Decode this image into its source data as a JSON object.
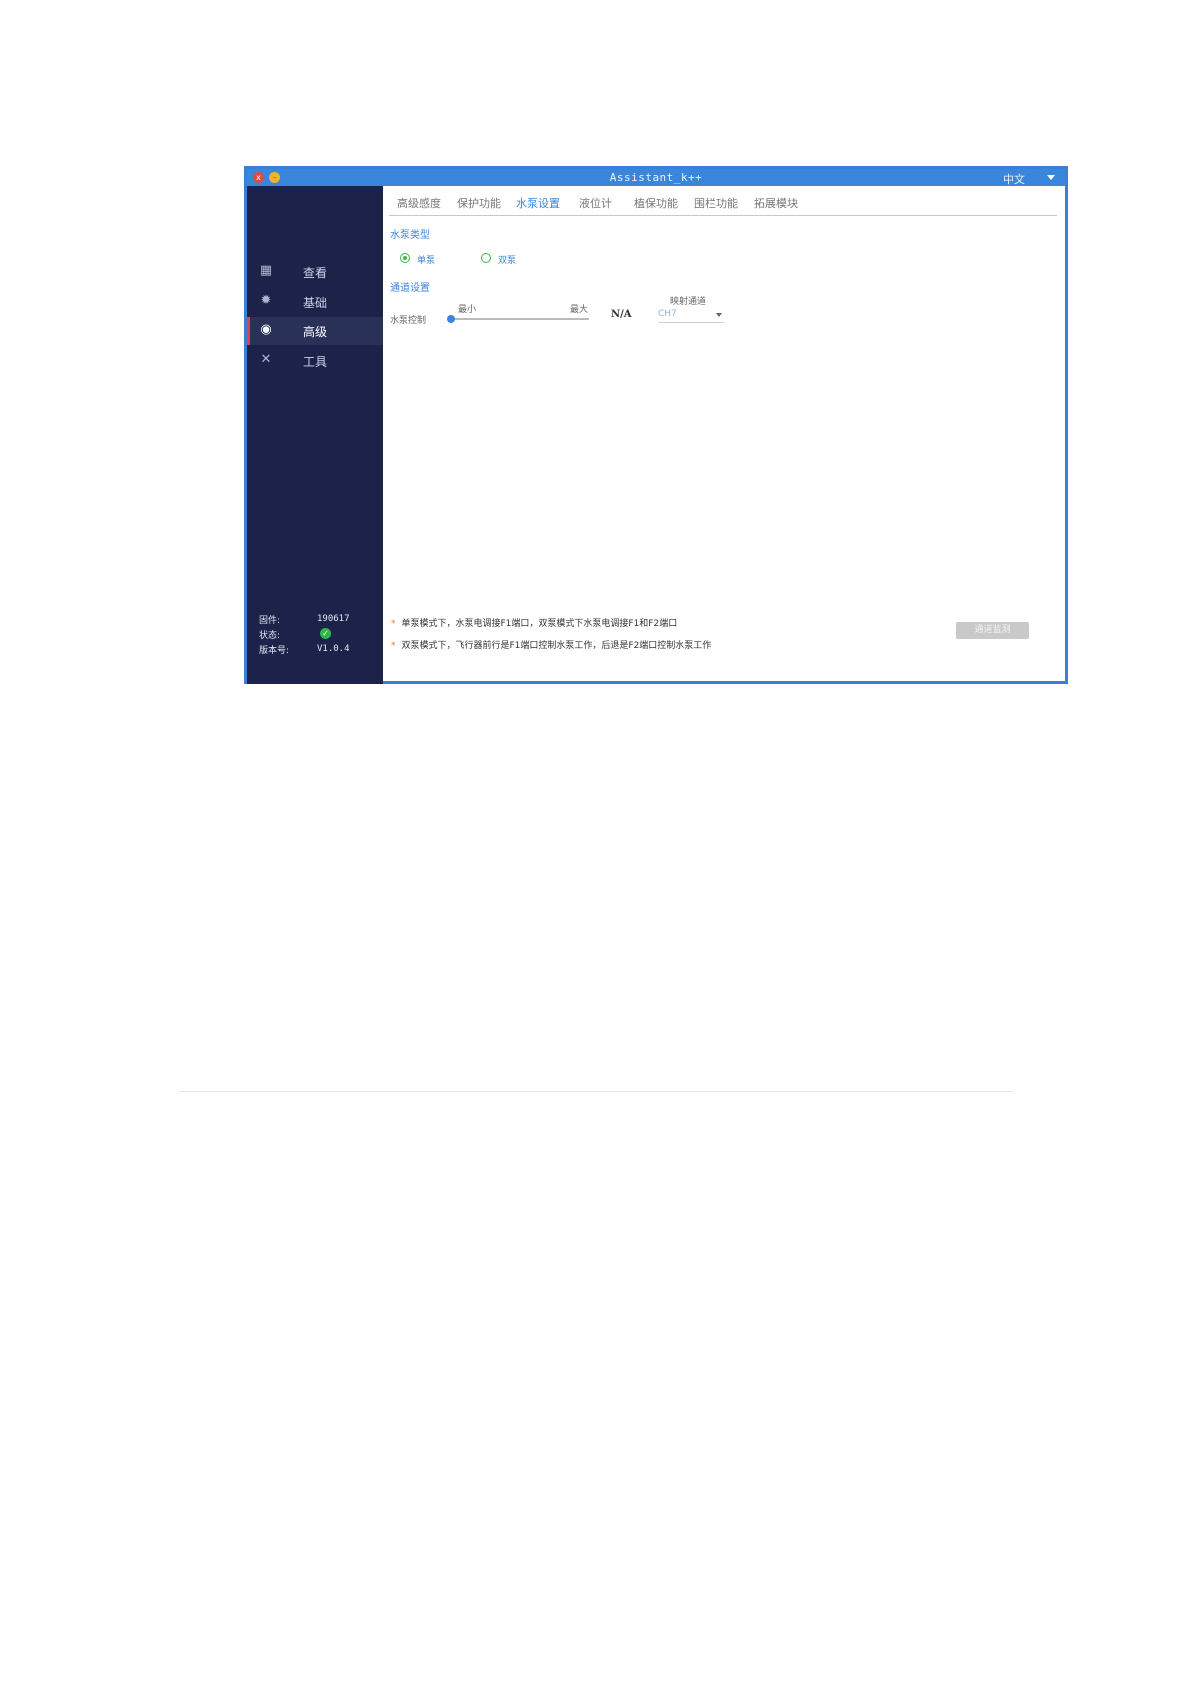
{
  "window": {
    "title": "Assistant_k++",
    "close_glyph": "x",
    "minimize_glyph": "–",
    "language": "中文"
  },
  "sidebar": {
    "items": [
      {
        "label": "查看",
        "icon": "grid-icon"
      },
      {
        "label": "基础",
        "icon": "gear-icon"
      },
      {
        "label": "高级",
        "icon": "shield-icon",
        "active": true
      },
      {
        "label": "工具",
        "icon": "tools-icon"
      }
    ],
    "info": {
      "firmware_label": "固件:",
      "firmware_value": "190617",
      "status_label": "状态:",
      "version_label": "版本号:",
      "version_value": "V1.0.4"
    }
  },
  "tabs": [
    {
      "label": "高级感度"
    },
    {
      "label": "保护功能"
    },
    {
      "label": "水泵设置",
      "active": true
    },
    {
      "label": "液位计"
    },
    {
      "label": "植保功能"
    },
    {
      "label": "围栏功能"
    },
    {
      "label": "拓展模块"
    }
  ],
  "pump": {
    "type_title": "水泵类型",
    "single_label": "单泵",
    "double_label": "双泵",
    "selected": "单泵",
    "channel_title": "通道设置",
    "control_label": "水泵控制",
    "min_label": "最小",
    "max_label": "最大",
    "slider_value": 0,
    "value_display": "N/A",
    "mapping_label": "映射通道",
    "mapping_value": "CH7"
  },
  "notes": [
    "单泵模式下，水泵电调接F1端口，双泵模式下水泵电调接F1和F2端口",
    "双泵模式下，飞行器前行是F1端口控制水泵工作，后退是F2端口控制水泵工作"
  ],
  "monitor_button": "通道监测",
  "colors": {
    "accent": "#3a86dc",
    "sidebar_bg": "#1c2249",
    "status_ok": "#2fb84a",
    "active_marker": "#d94452"
  }
}
